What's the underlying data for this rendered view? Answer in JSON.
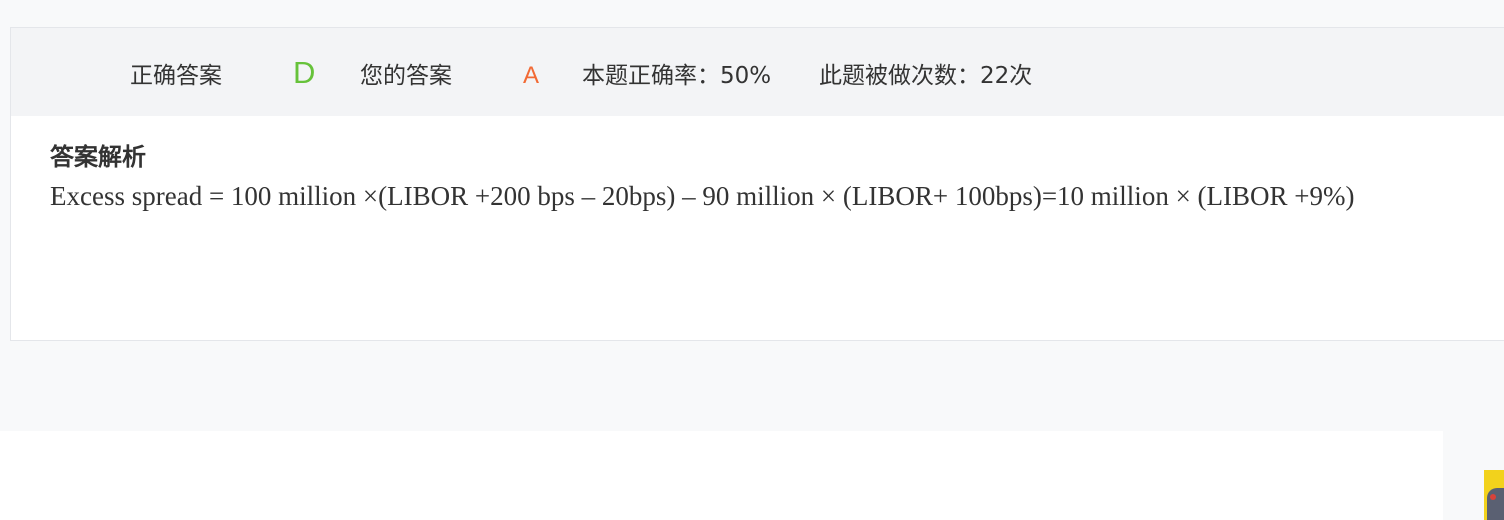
{
  "result": {
    "correct_label": "正确答案",
    "correct_value": "D",
    "your_label": "您的答案",
    "your_value": "A",
    "accuracy_text": "本题正确率：50%",
    "attempts_text": "此题被做次数：22次"
  },
  "analysis": {
    "title": "答案解析",
    "body": "Excess spread = 100 million ×(LIBOR +200 bps – 20bps) – 90 million × (LIBOR+ 100bps)=10 million × (LIBOR +9%)"
  },
  "colors": {
    "correct": "#66c23a",
    "wrong": "#f26a35",
    "bar_background": "#f3f4f6",
    "page_background": "#f8f9fa"
  },
  "icons": {
    "side_thumbnail": "mascot-avatar-icon"
  }
}
